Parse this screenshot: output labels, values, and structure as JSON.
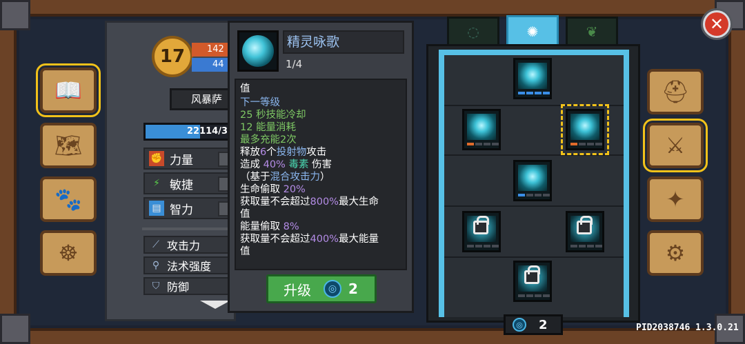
{
  "character": {
    "level": "17",
    "hp": "142",
    "mp": "44",
    "name": "风暴萨",
    "xp_text": "22114/3",
    "xp_fraction": 0.62,
    "attributes": [
      {
        "label": "力量",
        "icon": "strength-icon"
      },
      {
        "label": "敏捷",
        "icon": "agility-icon"
      },
      {
        "label": "智力",
        "icon": "intellect-icon"
      }
    ],
    "sub_stats": [
      {
        "label": "攻击力",
        "icon": "sword-icon"
      },
      {
        "label": "法术强度",
        "icon": "wand-icon"
      },
      {
        "label": "防御",
        "icon": "shield-icon"
      }
    ]
  },
  "tooltip": {
    "title": "精灵咏歌",
    "rank": "1/4",
    "lines": [
      {
        "parts": [
          {
            "t": "值",
            "c": ""
          }
        ]
      },
      {
        "parts": [
          {
            "t": "",
            "c": ""
          }
        ]
      },
      {
        "parts": [
          {
            "t": "下一等级",
            "c": "c-blue"
          }
        ]
      },
      {
        "parts": [
          {
            "t": "25 秒技能冷却",
            "c": "c-green"
          }
        ]
      },
      {
        "parts": [
          {
            "t": "12 能量消耗",
            "c": "c-green"
          }
        ]
      },
      {
        "parts": [
          {
            "t": "最多充能2次",
            "c": "c-green"
          }
        ]
      },
      {
        "parts": [
          {
            "t": "释放",
            "c": ""
          },
          {
            "t": "6",
            "c": "c-purple"
          },
          {
            "t": "个",
            "c": ""
          },
          {
            "t": "投射物",
            "c": "c-blue"
          },
          {
            "t": "攻击",
            "c": ""
          }
        ]
      },
      {
        "parts": [
          {
            "t": "造成 ",
            "c": ""
          },
          {
            "t": "40%",
            "c": "c-purple"
          },
          {
            "t": " 毒素",
            "c": "c-teal"
          },
          {
            "t": " 伤害",
            "c": ""
          }
        ]
      },
      {
        "parts": [
          {
            "t": "（基于",
            "c": ""
          },
          {
            "t": "混合攻击力",
            "c": "c-blue"
          },
          {
            "t": "）",
            "c": ""
          }
        ]
      },
      {
        "parts": [
          {
            "t": "生命偷取 ",
            "c": ""
          },
          {
            "t": "20%",
            "c": "c-purple"
          }
        ]
      },
      {
        "parts": [
          {
            "t": "获取量不会超过",
            "c": ""
          },
          {
            "t": "800%",
            "c": "c-purple"
          },
          {
            "t": "最大生命",
            "c": ""
          }
        ]
      },
      {
        "parts": [
          {
            "t": "值",
            "c": ""
          }
        ]
      },
      {
        "parts": [
          {
            "t": "能量偷取 ",
            "c": ""
          },
          {
            "t": "8%",
            "c": "c-purple"
          }
        ]
      },
      {
        "parts": [
          {
            "t": "获取量不会超过",
            "c": ""
          },
          {
            "t": "400%",
            "c": "c-purple"
          },
          {
            "t": "最大能量",
            "c": ""
          }
        ]
      },
      {
        "parts": [
          {
            "t": "值",
            "c": ""
          }
        ]
      }
    ],
    "upgrade_label": "升级",
    "upgrade_cost": "2"
  },
  "skill_points": "2",
  "version": "PID2038746 1.3.0.21",
  "nav_left": [
    {
      "name": "nav-book-icon",
      "glyph": "📖",
      "selected": true
    },
    {
      "name": "nav-map-icon",
      "glyph": "🗺"
    },
    {
      "name": "nav-pets-icon",
      "glyph": "🐾"
    },
    {
      "name": "nav-wheel-icon",
      "glyph": "☸"
    }
  ],
  "nav_right": [
    {
      "name": "nav-helmet-icon",
      "glyph": "⛑"
    },
    {
      "name": "nav-skills-icon",
      "glyph": "⚔",
      "selected": true
    },
    {
      "name": "nav-compass-icon",
      "glyph": "✦"
    },
    {
      "name": "nav-settings-icon",
      "glyph": "⚙"
    }
  ],
  "colors": {
    "accent": "#57c0e6",
    "gold": "#f2c21a",
    "upgrade": "#48a84c"
  }
}
